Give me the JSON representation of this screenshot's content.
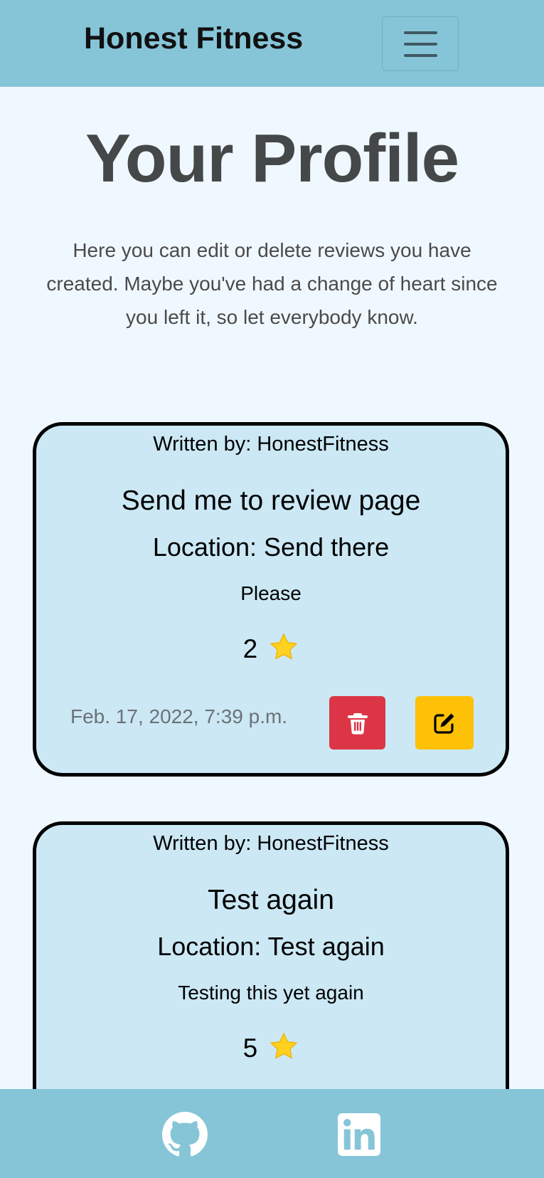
{
  "navbar": {
    "brand": "Honest Fitness",
    "menu_icon": "hamburger-menu-icon"
  },
  "page": {
    "title": "Your Profile",
    "intro": "Here you can edit or delete reviews you have created. Maybe you've had a change of heart since you left it, so let everybody know."
  },
  "reviews": [
    {
      "author": "Written by: HonestFitness",
      "title": "Send me to review page",
      "location": "Location: Send there",
      "body": "Please",
      "rating": "2",
      "date": "Feb. 17, 2022, 7:39 p.m.",
      "delete_icon": "trash-icon",
      "edit_icon": "edit-pencil-icon"
    },
    {
      "author": "Written by: HonestFitness",
      "title": "Test again",
      "location": "Location: Test again",
      "body": "Testing this yet again",
      "rating": "5"
    }
  ],
  "footer": {
    "links": [
      {
        "icon": "github-icon"
      },
      {
        "icon": "linkedin-icon"
      }
    ]
  },
  "colors": {
    "navbar_bg": "#86c5d8",
    "page_bg": "#f0f8ff",
    "card_bg": "#cbe8f4",
    "delete": "#dc3545",
    "edit": "#ffc107",
    "star": "#ffd21f"
  }
}
